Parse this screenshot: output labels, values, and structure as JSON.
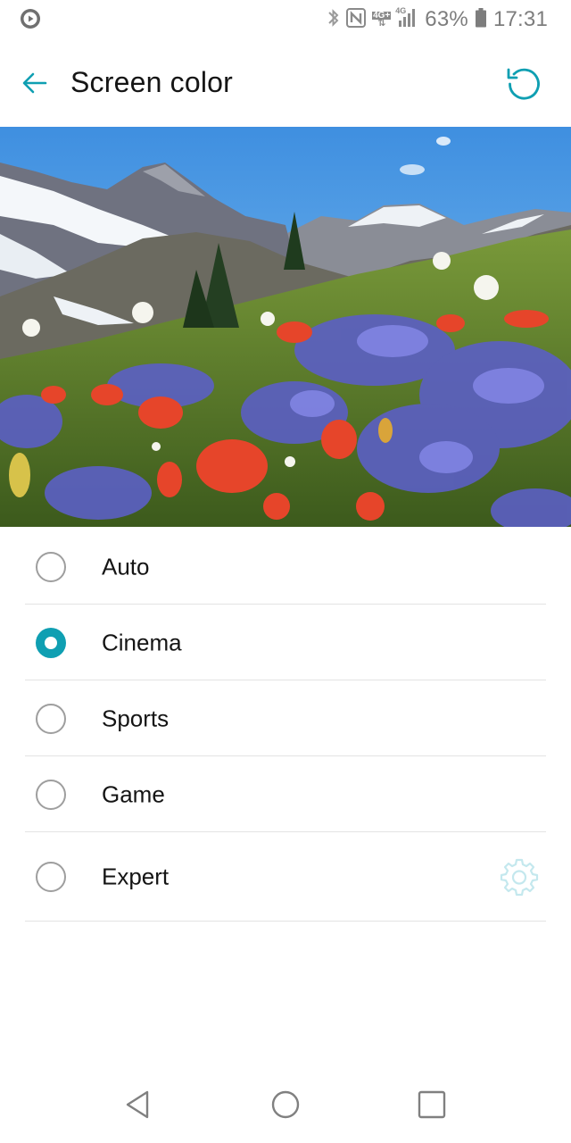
{
  "status_bar": {
    "battery_percent": "63%",
    "time": "17:31",
    "network_top": "4G+",
    "network_small": "4G",
    "icons": [
      "media-play-icon",
      "bluetooth-icon",
      "nfc-icon",
      "data-arrows-icon",
      "signal-icon",
      "battery-icon"
    ]
  },
  "toolbar": {
    "title": "Screen color",
    "back_icon": "arrow-left-icon",
    "reset_icon": "reset-icon"
  },
  "preview": {
    "subject": "mountain-wildflower-meadow-image"
  },
  "options": [
    {
      "label": "Auto",
      "selected": false
    },
    {
      "label": "Cinema",
      "selected": true
    },
    {
      "label": "Sports",
      "selected": false
    },
    {
      "label": "Game",
      "selected": false
    },
    {
      "label": "Expert",
      "selected": false,
      "settings_icon": "gear-icon"
    }
  ],
  "colors": {
    "accent": "#0f9fb2",
    "radio_unchecked": "#9e9e9e",
    "divider": "#e3e3e3"
  },
  "nav_bar": {
    "icons": [
      "nav-back-icon",
      "nav-home-icon",
      "nav-recents-icon"
    ]
  }
}
